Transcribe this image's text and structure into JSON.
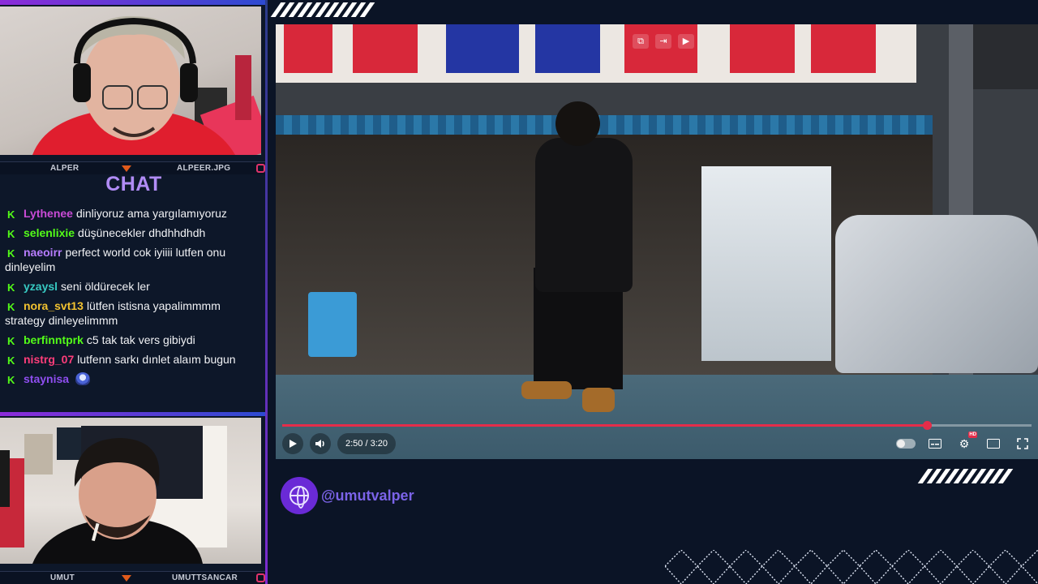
{
  "streamers": {
    "top": {
      "left_name": "ALPER",
      "right_name": "ALPEER.JPG"
    },
    "bottom": {
      "left_name": "UMUT",
      "right_name": "UMUTTSANCAR"
    }
  },
  "chat": {
    "title": "CHAT",
    "messages": [
      {
        "user": "Lythenee",
        "color": "#c94bd6",
        "text": "dinliyoruz ama yargılamıyoruz"
      },
      {
        "user": "selenlixie",
        "color": "#53fc18",
        "text": "düşünecekler dhdhhdhdh"
      },
      {
        "user": "naeoirr",
        "color": "#b77dff",
        "text": "perfect world cok iyiiii lutfen onu dinleyelim"
      },
      {
        "user": "yzaysl",
        "color": "#37c9c2",
        "text": "seni öldürecek ler"
      },
      {
        "user": "nora_svt13",
        "color": "#f2c230",
        "text": "lütfen istisna yapalimmmm strategy dinleyelimmm"
      },
      {
        "user": "berfinntprk",
        "color": "#53fc18",
        "text": "c5 tak tak vers gibiydi"
      },
      {
        "user": "nistrg_07",
        "color": "#ff3d7a",
        "text": "lutfenn sarkı dınlet alaım bugun"
      },
      {
        "user": "staynisa",
        "color": "#8f4ef0",
        "text": ""
      }
    ],
    "badge_icon": "kick-badge-icon",
    "emote_icon": "emote-icon"
  },
  "player": {
    "time": "2:50 / 3:20",
    "progress": 0.86,
    "accent": "#e52d4a"
  },
  "handle": {
    "text": "@umutvalper",
    "icon": "globe-icon"
  },
  "colors": {
    "background": "#0b1426",
    "accent_purple": "#6a2ad6"
  }
}
